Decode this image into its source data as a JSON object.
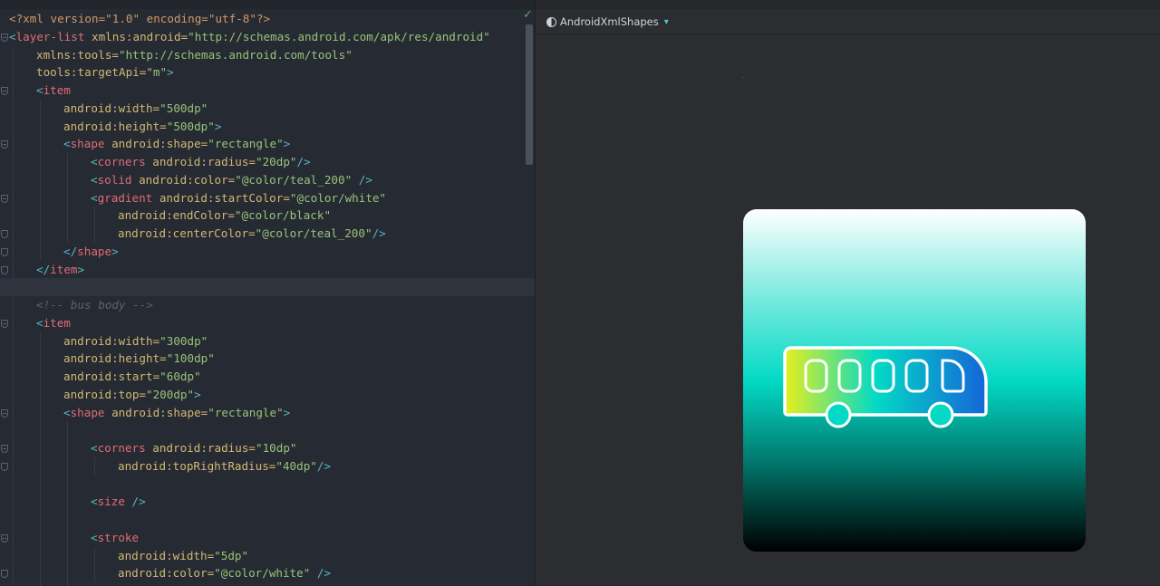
{
  "editor": {
    "lines": [
      {
        "fold": "none",
        "indent": 0,
        "tokens": [
          {
            "t": "<?xml version=\"1.0\" encoding=\"utf-8\"?>",
            "c": "decl"
          }
        ]
      },
      {
        "fold": "open",
        "indent": 0,
        "tokens": [
          {
            "t": "<",
            "c": "punc"
          },
          {
            "t": "layer-list",
            "c": "tag"
          },
          {
            "t": " xmlns:android=",
            "c": "attr"
          },
          {
            "t": "\"http://schemas.android.com/apk/res/android\"",
            "c": "str"
          }
        ]
      },
      {
        "fold": "none",
        "indent": 1,
        "tokens": [
          {
            "t": "xmlns:tools=",
            "c": "attr"
          },
          {
            "t": "\"http://schemas.android.com/tools\"",
            "c": "str"
          }
        ]
      },
      {
        "fold": "none",
        "indent": 1,
        "tokens": [
          {
            "t": "tools:targetApi=",
            "c": "attr"
          },
          {
            "t": "\"m\"",
            "c": "str"
          },
          {
            "t": ">",
            "c": "punc"
          }
        ]
      },
      {
        "fold": "open",
        "indent": 1,
        "tokens": [
          {
            "t": "<",
            "c": "punc"
          },
          {
            "t": "item",
            "c": "tag"
          }
        ]
      },
      {
        "fold": "none",
        "indent": 2,
        "tokens": [
          {
            "t": "android:width=",
            "c": "attr"
          },
          {
            "t": "\"500dp\"",
            "c": "str"
          }
        ]
      },
      {
        "fold": "none",
        "indent": 2,
        "tokens": [
          {
            "t": "android:height=",
            "c": "attr"
          },
          {
            "t": "\"500dp\"",
            "c": "str"
          },
          {
            "t": ">",
            "c": "punc"
          }
        ]
      },
      {
        "fold": "open",
        "indent": 2,
        "tokens": [
          {
            "t": "<",
            "c": "punc"
          },
          {
            "t": "shape",
            "c": "tag"
          },
          {
            "t": " android:shape=",
            "c": "attr"
          },
          {
            "t": "\"rectangle\"",
            "c": "str"
          },
          {
            "t": ">",
            "c": "punc"
          }
        ]
      },
      {
        "fold": "none",
        "indent": 3,
        "tokens": [
          {
            "t": "<",
            "c": "punc"
          },
          {
            "t": "corners",
            "c": "tag"
          },
          {
            "t": " android:radius=",
            "c": "attr"
          },
          {
            "t": "\"20dp\"",
            "c": "str"
          },
          {
            "t": "/>",
            "c": "punc"
          }
        ]
      },
      {
        "fold": "none",
        "indent": 3,
        "tokens": [
          {
            "t": "<",
            "c": "punc"
          },
          {
            "t": "solid",
            "c": "tag"
          },
          {
            "t": " android:color=",
            "c": "attr"
          },
          {
            "t": "\"@color/teal_200\"",
            "c": "str"
          },
          {
            "t": " />",
            "c": "punc"
          }
        ]
      },
      {
        "fold": "open",
        "indent": 3,
        "tokens": [
          {
            "t": "<",
            "c": "punc"
          },
          {
            "t": "gradient",
            "c": "tag"
          },
          {
            "t": " android:startColor=",
            "c": "attr"
          },
          {
            "t": "\"@color/white\"",
            "c": "str"
          }
        ]
      },
      {
        "fold": "none",
        "indent": 4,
        "tokens": [
          {
            "t": "android:endColor=",
            "c": "attr"
          },
          {
            "t": "\"@color/black\"",
            "c": "str"
          }
        ]
      },
      {
        "fold": "close",
        "indent": 4,
        "tokens": [
          {
            "t": "android:centerColor=",
            "c": "attr"
          },
          {
            "t": "\"@color/teal_200\"",
            "c": "str"
          },
          {
            "t": "/>",
            "c": "punc"
          }
        ]
      },
      {
        "fold": "close",
        "indent": 2,
        "tokens": [
          {
            "t": "</",
            "c": "punc"
          },
          {
            "t": "shape",
            "c": "tag"
          },
          {
            "t": ">",
            "c": "punc"
          }
        ]
      },
      {
        "fold": "close",
        "indent": 1,
        "tokens": [
          {
            "t": "</",
            "c": "punc"
          },
          {
            "t": "item",
            "c": "tag"
          },
          {
            "t": ">",
            "c": "punc"
          }
        ]
      },
      {
        "fold": "none",
        "indent": 0,
        "current": true,
        "tokens": []
      },
      {
        "fold": "none",
        "indent": 1,
        "tokens": [
          {
            "t": "<!-- bus body -->",
            "c": "com"
          }
        ]
      },
      {
        "fold": "open",
        "indent": 1,
        "tokens": [
          {
            "t": "<",
            "c": "punc"
          },
          {
            "t": "item",
            "c": "tag"
          }
        ]
      },
      {
        "fold": "none",
        "indent": 2,
        "tokens": [
          {
            "t": "android:width=",
            "c": "attr"
          },
          {
            "t": "\"300dp\"",
            "c": "str"
          }
        ]
      },
      {
        "fold": "none",
        "indent": 2,
        "tokens": [
          {
            "t": "android:height=",
            "c": "attr"
          },
          {
            "t": "\"100dp\"",
            "c": "str"
          }
        ]
      },
      {
        "fold": "none",
        "indent": 2,
        "tokens": [
          {
            "t": "android:start=",
            "c": "attr"
          },
          {
            "t": "\"60dp\"",
            "c": "str"
          }
        ]
      },
      {
        "fold": "none",
        "indent": 2,
        "tokens": [
          {
            "t": "android:top=",
            "c": "attr"
          },
          {
            "t": "\"200dp\"",
            "c": "str"
          },
          {
            "t": ">",
            "c": "punc"
          }
        ]
      },
      {
        "fold": "open",
        "indent": 2,
        "tokens": [
          {
            "t": "<",
            "c": "punc"
          },
          {
            "t": "shape",
            "c": "tag"
          },
          {
            "t": " android:shape=",
            "c": "attr"
          },
          {
            "t": "\"rectangle\"",
            "c": "str"
          },
          {
            "t": ">",
            "c": "punc"
          }
        ]
      },
      {
        "fold": "none",
        "indent": 3,
        "tokens": []
      },
      {
        "fold": "open",
        "indent": 3,
        "tokens": [
          {
            "t": "<",
            "c": "punc"
          },
          {
            "t": "corners",
            "c": "tag"
          },
          {
            "t": " android:radius=",
            "c": "attr"
          },
          {
            "t": "\"10dp\"",
            "c": "str"
          }
        ]
      },
      {
        "fold": "close",
        "indent": 4,
        "tokens": [
          {
            "t": "android:topRightRadius=",
            "c": "attr"
          },
          {
            "t": "\"40dp\"",
            "c": "str"
          },
          {
            "t": "/>",
            "c": "punc"
          }
        ]
      },
      {
        "fold": "none",
        "indent": 3,
        "tokens": []
      },
      {
        "fold": "none",
        "indent": 3,
        "tokens": [
          {
            "t": "<",
            "c": "punc"
          },
          {
            "t": "size",
            "c": "tag"
          },
          {
            "t": " />",
            "c": "punc"
          }
        ]
      },
      {
        "fold": "none",
        "indent": 3,
        "tokens": []
      },
      {
        "fold": "open",
        "indent": 3,
        "tokens": [
          {
            "t": "<",
            "c": "punc"
          },
          {
            "t": "stroke",
            "c": "tag"
          }
        ]
      },
      {
        "fold": "none",
        "indent": 4,
        "tokens": [
          {
            "t": "android:width=",
            "c": "attr"
          },
          {
            "t": "\"5dp\"",
            "c": "str"
          }
        ]
      },
      {
        "fold": "close",
        "indent": 4,
        "tokens": [
          {
            "t": "android:color=",
            "c": "attr"
          },
          {
            "t": "\"@color/white\"",
            "c": "str"
          },
          {
            "t": " />",
            "c": "punc"
          }
        ]
      },
      {
        "fold": "none",
        "indent": 3,
        "tokens": []
      }
    ],
    "status_icon": "check-icon",
    "colors": {
      "background": "#262a33",
      "tag": "#e06c75",
      "punctuation": "#56b6c2",
      "attribute": "#d1b873",
      "string": "#98c379",
      "comment": "#5c6370"
    }
  },
  "preview": {
    "device_label": "AndroidXmlShapes",
    "device_icon": "theme-icon",
    "dropdown_icon": "chevron-down-icon",
    "drawable": {
      "gradient": [
        "#ffffff",
        "#03dac5",
        "#000000"
      ],
      "bus_gradient": [
        "#e6ef1e",
        "#03dac5",
        "#1565d8"
      ],
      "stroke_color": "#ffffff",
      "wheel_color": "#03dac5"
    }
  }
}
